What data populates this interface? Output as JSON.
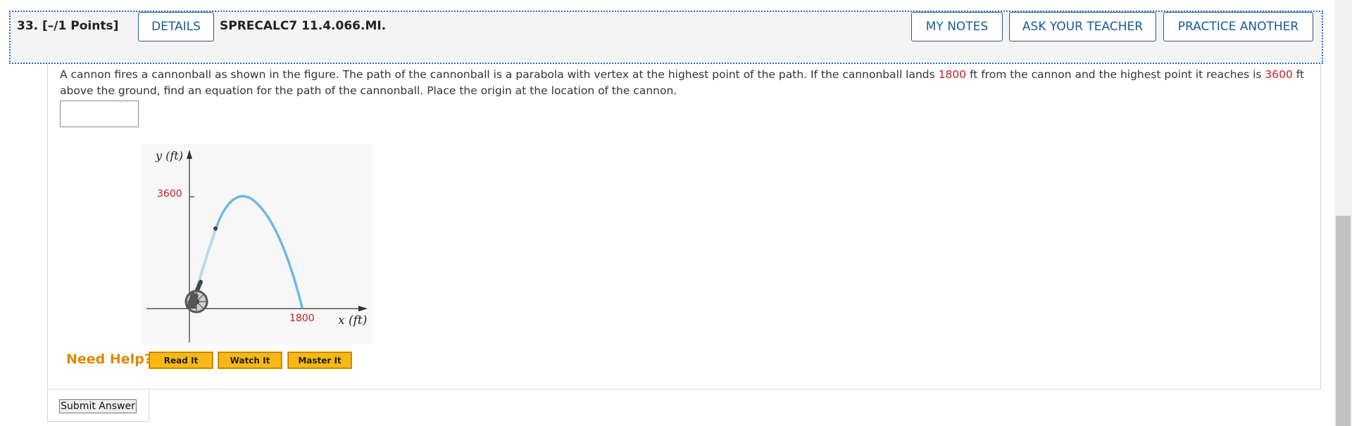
{
  "question": {
    "number_points": "33.  [–/1 Points]",
    "details_label": "DETAILS",
    "code": "SPRECALC7 11.4.066.MI.",
    "my_notes_label": "MY NOTES",
    "ask_teacher_label": "ASK YOUR TEACHER",
    "practice_label": "PRACTICE ANOTHER",
    "text_part1": "A cannon fires a cannonball as shown in the figure. The path of the cannonball is a parabola with vertex at the highest point of the path. If the cannonball lands ",
    "distance": "1800",
    "text_part2": " ft from the cannon and the highest point it reaches is ",
    "height": "3600",
    "text_part3": " ft above the ground, find an equation for the path of the cannonball. Place the origin at the location of the cannon.",
    "answer_value": ""
  },
  "figure": {
    "y_axis_label": "y (ft)",
    "x_axis_label": "x (ft)",
    "y_tick": "3600",
    "x_tick": "1800"
  },
  "help": {
    "need_help_label": "Need Help?",
    "read_it": "Read It",
    "watch_it": "Watch It",
    "master_it": "Master It"
  },
  "submit_label": "Submit Answer"
}
